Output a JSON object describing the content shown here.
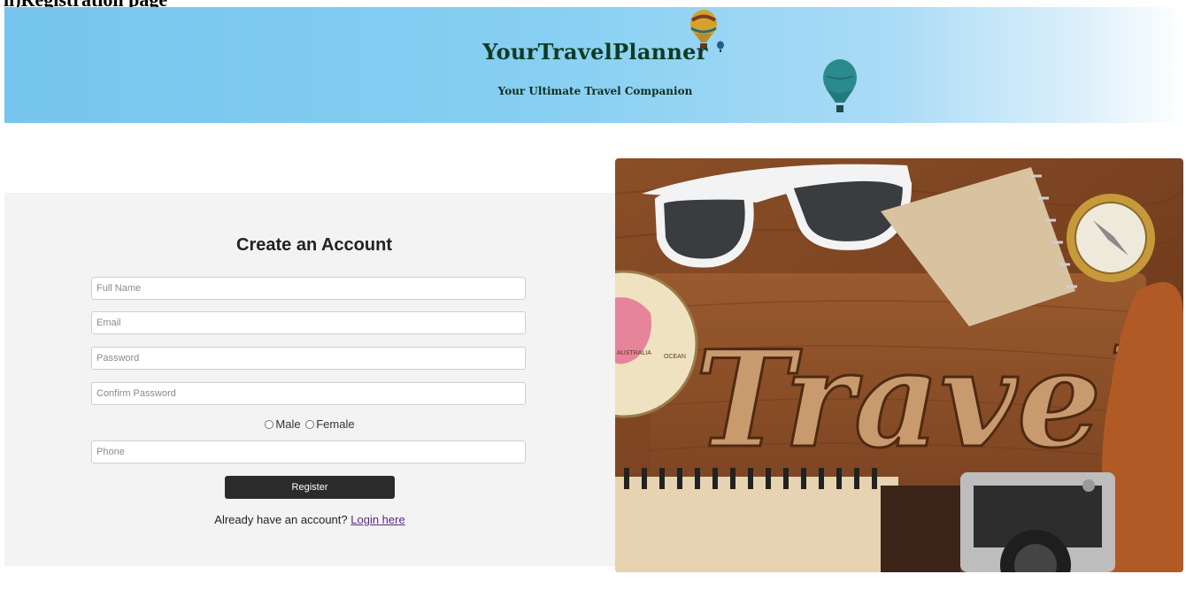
{
  "document": {
    "caption": "ii)Registration page"
  },
  "banner": {
    "title": "YourTravelPlanner",
    "subtitle": "Your Ultimate Travel Companion"
  },
  "form": {
    "heading": "Create an Account",
    "fields": {
      "full_name": {
        "placeholder": "Full Name",
        "value": ""
      },
      "email": {
        "placeholder": "Email",
        "value": ""
      },
      "password": {
        "placeholder": "Password",
        "value": ""
      },
      "confirm_password": {
        "placeholder": "Confirm Password",
        "value": ""
      },
      "phone": {
        "placeholder": "Phone",
        "value": ""
      }
    },
    "gender": {
      "male_label": "Male",
      "female_label": "Female"
    },
    "register_label": "Register",
    "login_prompt": "Already have an account?",
    "login_link": "Login here"
  },
  "photo": {
    "word": "Travel",
    "map_label_1": "AUSTRALIA",
    "map_label_2": "OCEAN"
  },
  "colors": {
    "banner_blue": "#86cff2",
    "card_bg": "#f3f3f3",
    "button_bg": "#2b2b2b",
    "link": "#5b2a86",
    "title_green": "#0e3b24"
  },
  "icons": [
    "hot-air-balloon-icon"
  ]
}
